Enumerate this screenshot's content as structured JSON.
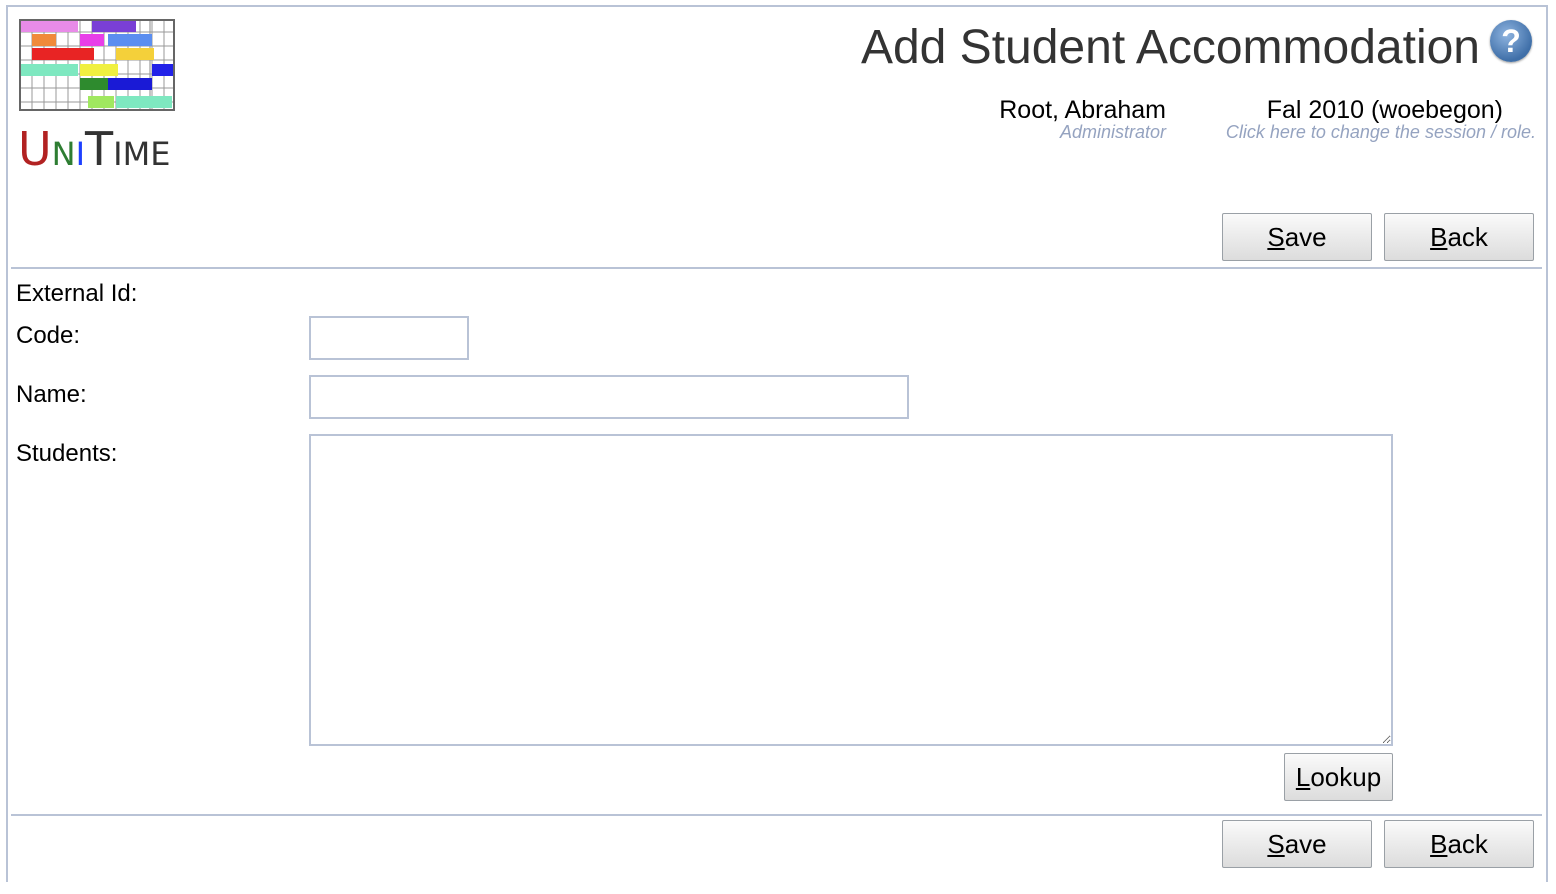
{
  "header": {
    "title": "Add Student Accommodation",
    "help_icon_glyph": "?",
    "user": {
      "name": "Root, Abraham",
      "role": "Administrator"
    },
    "session": {
      "name": "Fal 2010 (woebegon)",
      "hint": "Click here to change the session / role."
    },
    "logo": {
      "text_u": "U",
      "text_n": "N",
      "text_i": "I",
      "text_t": "T",
      "text_ime": "IME"
    }
  },
  "toolbar_top": {
    "save_u": "S",
    "save_rest": "ave",
    "back_u": "B",
    "back_rest": "ack"
  },
  "form": {
    "external_id_label": "External Id:",
    "code_label": "Code:",
    "code_value": "",
    "name_label": "Name:",
    "name_value": "",
    "students_label": "Students:",
    "students_value": "",
    "lookup_u": "L",
    "lookup_rest": "ookup"
  },
  "toolbar_bottom": {
    "save_u": "S",
    "save_rest": "ave",
    "back_u": "B",
    "back_rest": "ack"
  },
  "colors": {
    "border": "#b9c3d6",
    "hint": "#95a3c0",
    "title": "#333333"
  }
}
